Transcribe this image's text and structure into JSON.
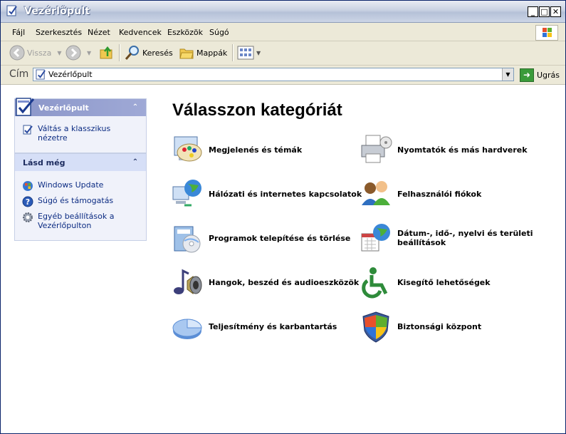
{
  "window": {
    "title": "Vezérlőpult"
  },
  "menu": [
    "Fájl",
    "Szerkesztés",
    "Nézet",
    "Kedvencek",
    "Eszközök",
    "Súgó"
  ],
  "toolbar": {
    "back": "Vissza",
    "search": "Keresés",
    "folders": "Mappák"
  },
  "address": {
    "label": "Cím",
    "value": "Vezérlőpult",
    "go": "Ugrás"
  },
  "sidebar": {
    "panel1": {
      "title": "Vezérlőpult",
      "link": "Váltás a klasszikus nézetre"
    },
    "panel2": {
      "title": "Lásd még",
      "links": [
        "Windows Update",
        "Súgó és támogatás",
        "Egyéb beállítások a Vezérlőpulton"
      ]
    }
  },
  "main": {
    "heading": "Válasszon kategóriát",
    "categories": [
      "Megjelenés és témák",
      "Hálózati és internetes kapcsolatok",
      "Programok telepítése és törlése",
      "Hangok, beszéd és audioeszközök",
      "Teljesítmény és karbantartás",
      "Nyomtatók és más hardverek",
      "Felhasználói fiókok",
      "Dátum-, idő-, nyelvi és területi beállítások",
      "Kisegítő lehetőségek",
      "Biztonsági központ"
    ]
  }
}
